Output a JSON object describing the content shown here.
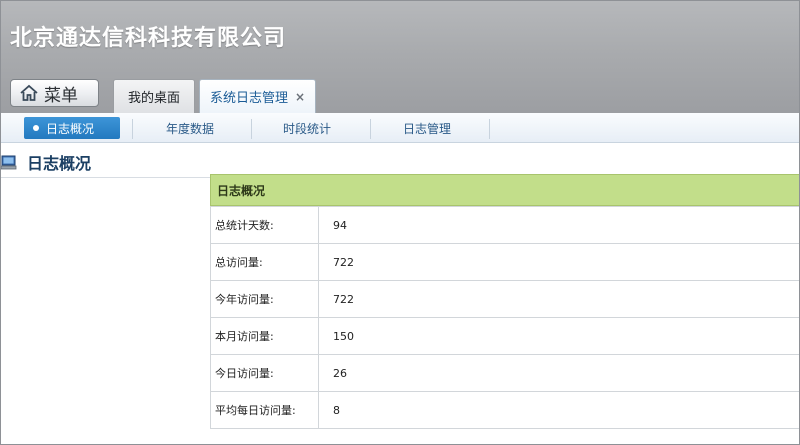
{
  "header": {
    "company": "北京通达信科科技有限公司",
    "menu_label": "菜单"
  },
  "tabs": [
    {
      "label": "我的桌面",
      "active": false
    },
    {
      "label": "系统日志管理",
      "active": true,
      "close": "×"
    }
  ],
  "subnav": [
    {
      "label": "日志概况",
      "active": true
    },
    {
      "label": "年度数据",
      "active": false
    },
    {
      "label": "时段统计",
      "active": false
    },
    {
      "label": "日志管理",
      "active": false
    }
  ],
  "page": {
    "title": "日志概况"
  },
  "panel": {
    "heading": "日志概况",
    "rows": [
      {
        "label": "总统计天数:",
        "value": "94"
      },
      {
        "label": "总访问量:",
        "value": "722"
      },
      {
        "label": "今年访问量:",
        "value": "722"
      },
      {
        "label": "本月访问量:",
        "value": "150"
      },
      {
        "label": "今日访问量:",
        "value": "26"
      },
      {
        "label": "平均每日访问量:",
        "value": "8"
      }
    ]
  },
  "colors": {
    "header": "#a9abae",
    "active_tab_text": "#1b5c96",
    "panel_head": "#c2de8a",
    "subnav_active": "#2379bf"
  }
}
